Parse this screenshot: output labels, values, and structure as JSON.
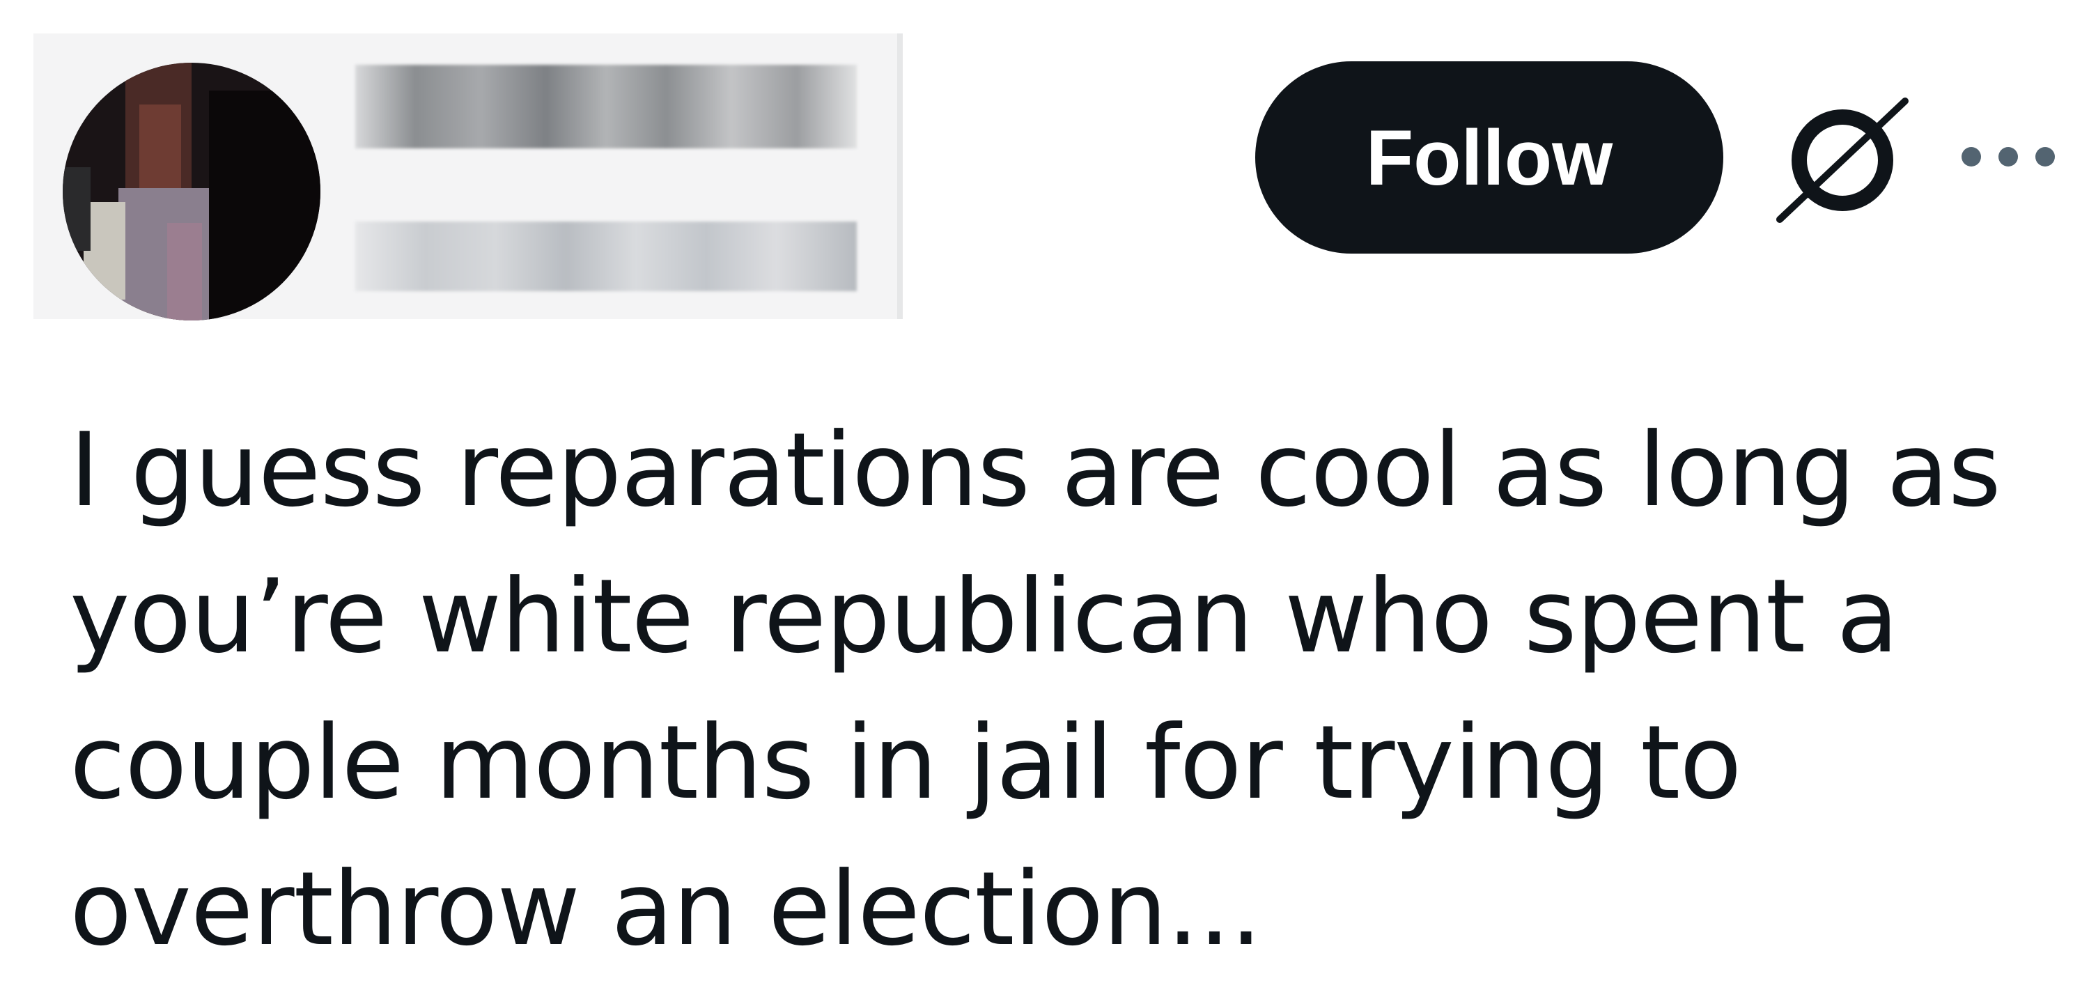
{
  "header": {
    "follow_label": "Follow",
    "icons": {
      "grok": "grok-icon",
      "more": "more-options-icon"
    }
  },
  "tweet": {
    "text": "I guess reparations are cool as long as\nyou’re white republican who spent a\ncouple months in jail for trying to\noverthrow an election..."
  },
  "colors": {
    "text": "#0f1419",
    "button_bg": "#0f1419",
    "button_text": "#ffffff",
    "icon_muted": "#536471"
  }
}
